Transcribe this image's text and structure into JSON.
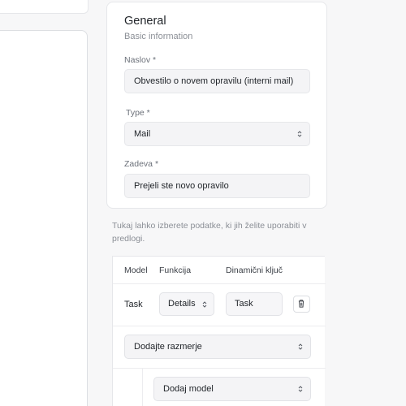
{
  "general": {
    "title": "General",
    "subtitle": "Basic information",
    "naslov_label": "Naslov *",
    "naslov_value": "Obvestilo o novem opravilu (interni mail)",
    "type_label": "Type *",
    "type_value": "Mail",
    "zadeva_label": "Zadeva *",
    "zadeva_value": "Prejeli ste novo opravilo"
  },
  "help_text": "Tukaj lahko izberete podatke, ki jih želite uporabiti v predlogi.",
  "table": {
    "headers": [
      "Model",
      "Funkcija",
      "Dinamični ključ"
    ],
    "row": {
      "model": "Task",
      "function_value": "Details",
      "dynamic_key": "Task"
    },
    "add_relation_label": "Dodajte razmerje",
    "add_model_label": "Dodaj model"
  },
  "icons": {
    "select": "chevron-updown-icon",
    "delete": "trash-icon"
  }
}
